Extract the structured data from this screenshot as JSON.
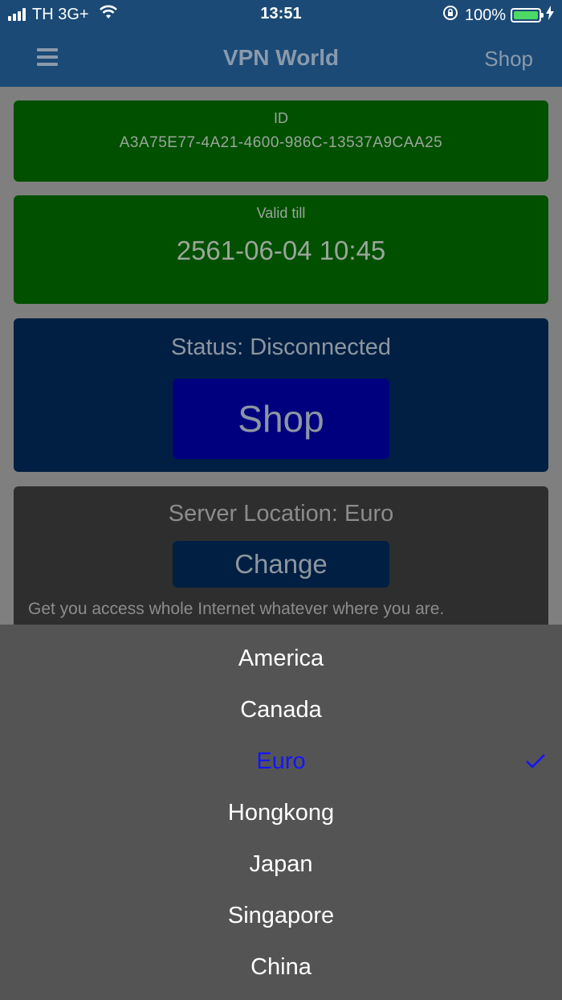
{
  "status_bar": {
    "carrier": "TH 3G+",
    "time": "13:51",
    "battery": "100%"
  },
  "nav": {
    "title": "VPN World",
    "shop_label": "Shop"
  },
  "id_card": {
    "label": "ID",
    "value": "A3A75E77-4A21-4600-986C-13537A9CAA25"
  },
  "valid_card": {
    "label": "Valid till",
    "value": "2561-06-04 10:45"
  },
  "status_card": {
    "status_text": "Status: Disconnected",
    "button_label": "Shop"
  },
  "server_card": {
    "location_text": "Server Location: Euro",
    "button_label": "Change",
    "description": "Get you access whole Internet whatever where you are."
  },
  "picker": {
    "items": [
      "America",
      "Canada",
      "Euro",
      "Hongkong",
      "Japan",
      "Singapore",
      "China"
    ],
    "selected": "Euro"
  },
  "colors": {
    "nav_bg": "#1b4a76",
    "green_card": "#015000",
    "status_card": "#001f42",
    "shop_button": "#00007f",
    "selected_text": "#1515ff"
  }
}
